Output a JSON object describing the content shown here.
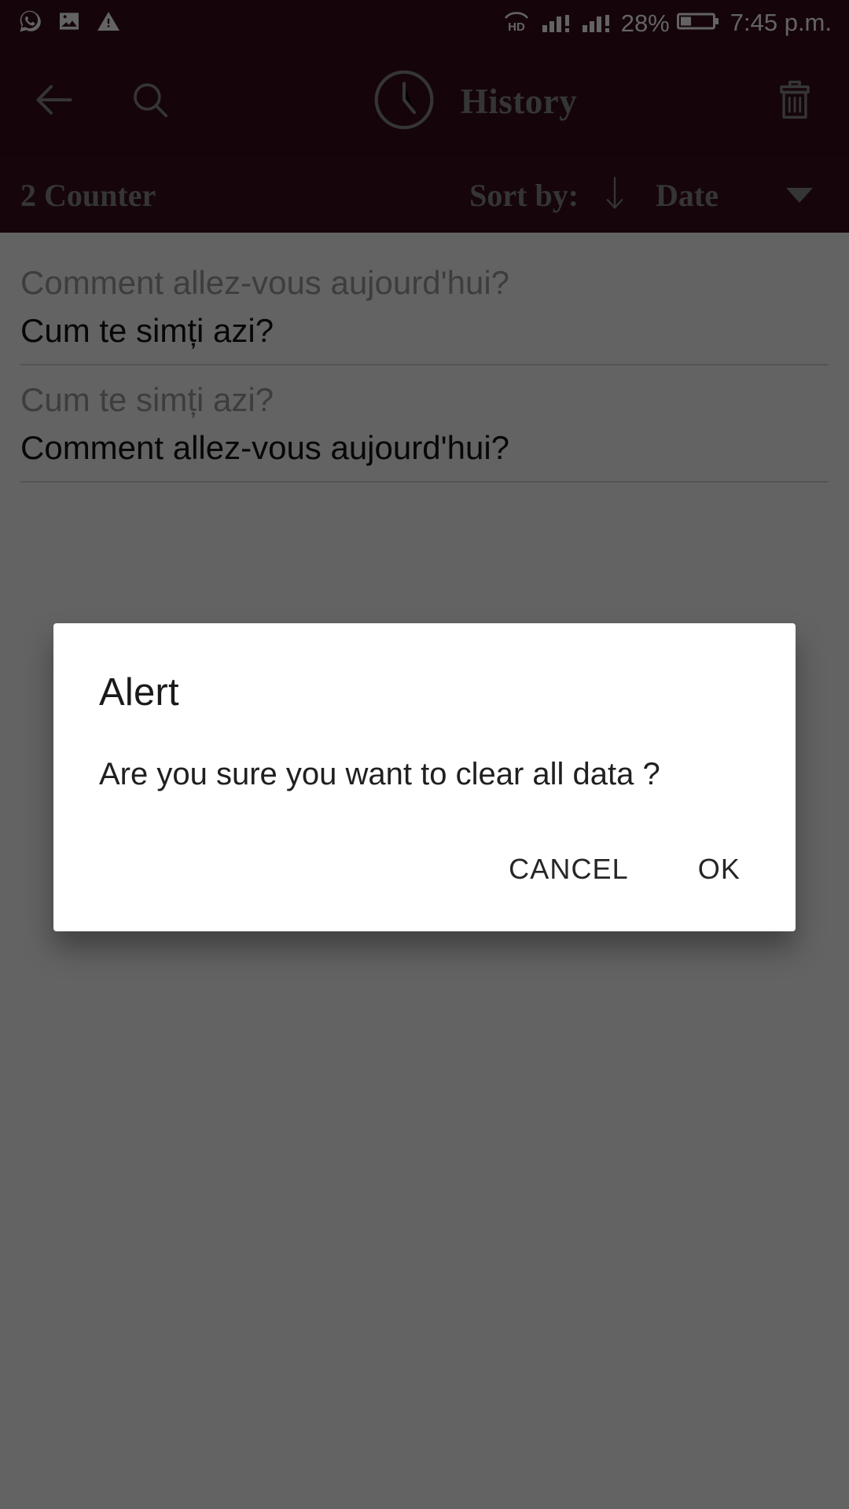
{
  "status_bar": {
    "icons_left": [
      "whatsapp-icon",
      "image-icon",
      "warning-icon"
    ],
    "volte_label": "HD",
    "signal_1": "signal-bars-alert-icon",
    "signal_2": "signal-bars-alert-icon",
    "battery_percent": "28%",
    "battery": "battery-icon",
    "time": "7:45 p.m."
  },
  "toolbar": {
    "back_icon": "arrow-left-icon",
    "search_icon": "search-icon",
    "clock_icon": "clock-icon",
    "title": "History",
    "delete_icon": "trash-icon"
  },
  "subheader": {
    "counter": "2 Counter",
    "sort_label": "Sort by:",
    "sort_direction_icon": "arrow-down-icon",
    "sort_value": "Date",
    "dropdown_icon": "caret-down-icon"
  },
  "history": {
    "items": [
      {
        "source": "Comment allez-vous aujourd'hui?",
        "target": "Cum te simți azi?"
      },
      {
        "source": "Cum te simți azi?",
        "target": "Comment allez-vous aujourd'hui?"
      }
    ]
  },
  "dialog": {
    "title": "Alert",
    "message": "Are you sure you want to clear all data ?",
    "cancel_label": "CANCEL",
    "ok_label": "OK"
  },
  "colors": {
    "toolbar_bg": "#370E1C",
    "subheader_bg": "#3A0F1E",
    "toolbar_fg": "#8A8A8A",
    "status_fg": "#FFFFFF",
    "scrim": "rgba(0,0,0,0.61)",
    "dialog_bg": "#FFFFFF",
    "source_text": "#9E9E9E",
    "target_text": "#121212"
  }
}
